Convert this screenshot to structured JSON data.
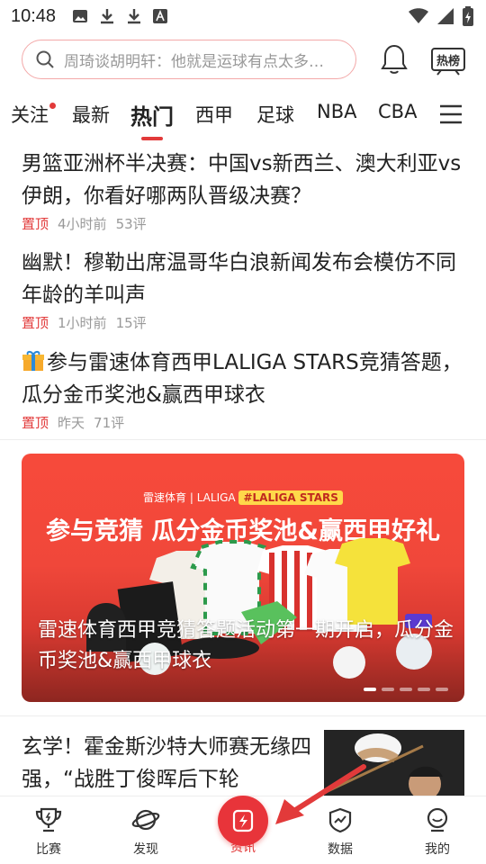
{
  "status_bar": {
    "time": "10:48"
  },
  "search": {
    "placeholder": "周琦谈胡明轩：他就是运球有点太多…"
  },
  "header": {
    "hot_label": "热榜"
  },
  "tabs": [
    {
      "label": "关注"
    },
    {
      "label": "最新"
    },
    {
      "label": "热门"
    },
    {
      "label": "西甲"
    },
    {
      "label": "足球"
    },
    {
      "label": "NBA"
    },
    {
      "label": "CBA"
    }
  ],
  "active_tab": "热门",
  "news": [
    {
      "title": "男篮亚洲杯半决赛：中国vs新西兰、澳大利亚vs伊朗，你看好哪两队晋级决赛？",
      "pin": "置顶",
      "time": "4小时前",
      "comments": "53评"
    },
    {
      "title": "幽默！穆勒出席温哥华白浪新闻发布会模仿不同年龄的羊叫声",
      "pin": "置顶",
      "time": "1小时前",
      "comments": "15评"
    },
    {
      "title": "参与雷速体育西甲LALIGA STARS竞猜答题，瓜分金币奖池&赢西甲球衣",
      "pin": "置顶",
      "time": "昨天",
      "comments": "71评"
    }
  ],
  "banner": {
    "brand": "雷速体育 | LALIGA",
    "tag": "#LALIGA STARS",
    "headline": "参与竞猜 瓜分金币奖池&赢西甲好礼",
    "caption": "雷速体育西甲竞猜答题活动第一期开启，瓜分金币奖池&赢西甲球衣",
    "slide_count": 5,
    "active_slide": 1
  },
  "feature_news": {
    "title": "玄学！霍金斯沙特大师赛无缘四强，“战胜丁俊晖后下轮"
  },
  "bottom_nav": [
    {
      "label": "比赛",
      "icon": "trophy-icon"
    },
    {
      "label": "发现",
      "icon": "planet-icon"
    },
    {
      "label": "资讯",
      "icon": "lightning-icon"
    },
    {
      "label": "数据",
      "icon": "chart-shield-icon"
    },
    {
      "label": "我的",
      "icon": "profile-icon"
    }
  ],
  "active_nav": "资讯",
  "colors": {
    "accent": "#e23a3a",
    "banner": "#f74a3b"
  }
}
